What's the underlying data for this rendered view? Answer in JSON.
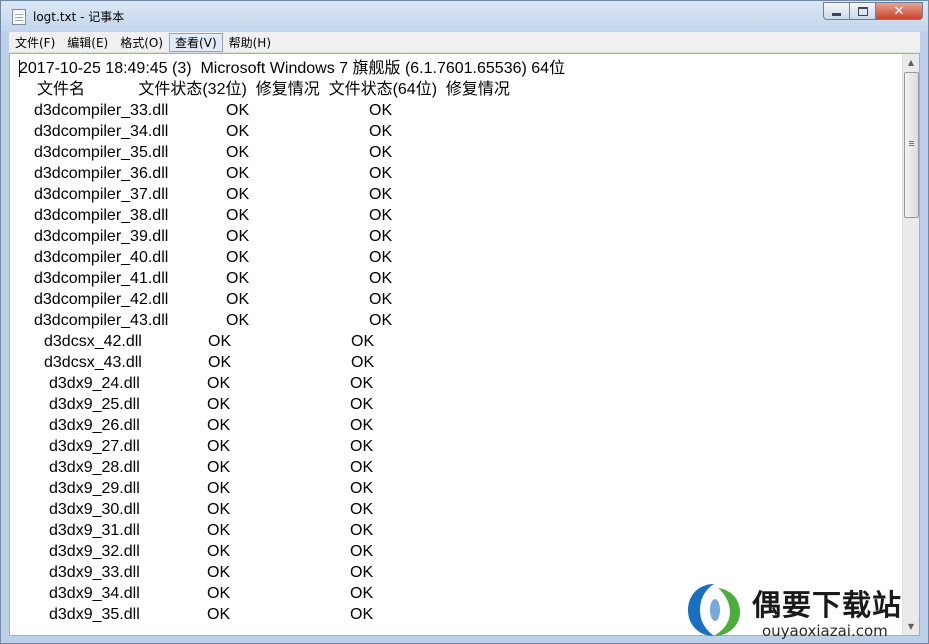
{
  "window": {
    "title": "logt.txt - 记事本"
  },
  "menu": [
    {
      "label": "文件(F)"
    },
    {
      "label": "编辑(E)"
    },
    {
      "label": "格式(O)"
    },
    {
      "label": "查看(V)"
    },
    {
      "label": "帮助(H)"
    }
  ],
  "document": {
    "header_line": "2017-10-25 18:49:45 (3)  Microsoft Windows 7 旗舰版 (6.1.7601.65536) 64位",
    "column_header_line": "文件名            文件状态(32位)  修复情况  文件状态(64位)  修复情况",
    "rows": [
      {
        "file": "d3dcompiler_33.dll",
        "status32": "OK",
        "status64": "OK"
      },
      {
        "file": "d3dcompiler_34.dll",
        "status32": "OK",
        "status64": "OK"
      },
      {
        "file": "d3dcompiler_35.dll",
        "status32": "OK",
        "status64": "OK"
      },
      {
        "file": "d3dcompiler_36.dll",
        "status32": "OK",
        "status64": "OK"
      },
      {
        "file": "d3dcompiler_37.dll",
        "status32": "OK",
        "status64": "OK"
      },
      {
        "file": "d3dcompiler_38.dll",
        "status32": "OK",
        "status64": "OK"
      },
      {
        "file": "d3dcompiler_39.dll",
        "status32": "OK",
        "status64": "OK"
      },
      {
        "file": "d3dcompiler_40.dll",
        "status32": "OK",
        "status64": "OK"
      },
      {
        "file": "d3dcompiler_41.dll",
        "status32": "OK",
        "status64": "OK"
      },
      {
        "file": "d3dcompiler_42.dll",
        "status32": "OK",
        "status64": "OK"
      },
      {
        "file": "d3dcompiler_43.dll",
        "status32": "OK",
        "status64": "OK"
      },
      {
        "file": "d3dcsx_42.dll",
        "status32": "OK",
        "status64": "OK"
      },
      {
        "file": "d3dcsx_43.dll",
        "status32": "OK",
        "status64": "OK"
      },
      {
        "file": "d3dx9_24.dll",
        "status32": "OK",
        "status64": "OK"
      },
      {
        "file": "d3dx9_25.dll",
        "status32": "OK",
        "status64": "OK"
      },
      {
        "file": "d3dx9_26.dll",
        "status32": "OK",
        "status64": "OK"
      },
      {
        "file": "d3dx9_27.dll",
        "status32": "OK",
        "status64": "OK"
      },
      {
        "file": "d3dx9_28.dll",
        "status32": "OK",
        "status64": "OK"
      },
      {
        "file": "d3dx9_29.dll",
        "status32": "OK",
        "status64": "OK"
      },
      {
        "file": "d3dx9_30.dll",
        "status32": "OK",
        "status64": "OK"
      },
      {
        "file": "d3dx9_31.dll",
        "status32": "OK",
        "status64": "OK"
      },
      {
        "file": "d3dx9_32.dll",
        "status32": "OK",
        "status64": "OK"
      },
      {
        "file": "d3dx9_33.dll",
        "status32": "OK",
        "status64": "OK"
      },
      {
        "file": "d3dx9_34.dll",
        "status32": "OK",
        "status64": "OK"
      },
      {
        "file": "d3dx9_35.dll",
        "status32": "OK",
        "status64": "OK"
      }
    ]
  },
  "watermark": {
    "name": "偶要下载站",
    "url": "ouyaoxiazai.com"
  },
  "icons": {
    "app": "notepad-icon",
    "minimize": "minimize-icon",
    "maximize": "maximize-icon",
    "close": "close-icon",
    "scroll_up": "scroll-up-icon",
    "scroll_down": "scroll-down-icon"
  },
  "colors": {
    "close_button": "#c7432a",
    "titlebar": "#c4d6ec",
    "watermark_blue": "#1a6fc0",
    "watermark_green": "#4cae3a"
  }
}
